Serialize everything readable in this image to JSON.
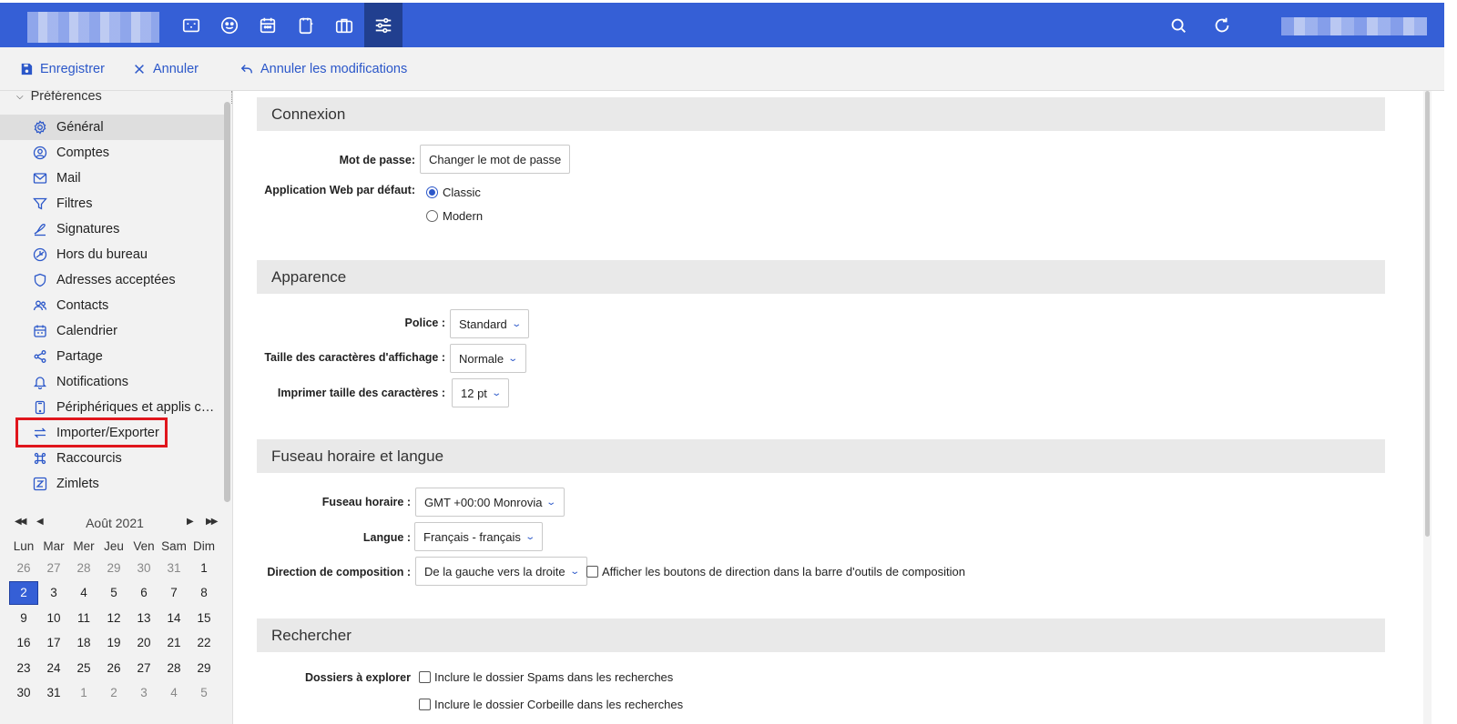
{
  "topbar": {
    "apps": [
      {
        "name": "mail-app-icon"
      },
      {
        "name": "contacts-app-icon"
      },
      {
        "name": "calendar-app-icon"
      },
      {
        "name": "tasks-app-icon"
      },
      {
        "name": "briefcase-app-icon"
      },
      {
        "name": "preferences-app-icon",
        "active": true
      }
    ],
    "accent": "#355fd6"
  },
  "toolbar": {
    "save_label": "Enregistrer",
    "cancel_label": "Annuler",
    "undo_label": "Annuler les modifications"
  },
  "sidebar": {
    "tree_label": "Préférences",
    "items": [
      {
        "label": "Général",
        "icon": "gear-icon",
        "active": true
      },
      {
        "label": "Comptes",
        "icon": "account-icon"
      },
      {
        "label": "Mail",
        "icon": "envelope-icon"
      },
      {
        "label": "Filtres",
        "icon": "filter-icon"
      },
      {
        "label": "Signatures",
        "icon": "signature-icon"
      },
      {
        "label": "Hors du bureau",
        "icon": "out-of-office-icon"
      },
      {
        "label": "Adresses acceptées",
        "icon": "shield-icon"
      },
      {
        "label": "Contacts",
        "icon": "people-icon"
      },
      {
        "label": "Calendrier",
        "icon": "calendar-icon"
      },
      {
        "label": "Partage",
        "icon": "share-icon"
      },
      {
        "label": "Notifications",
        "icon": "bell-icon"
      },
      {
        "label": "Périphériques et applis connectés",
        "icon": "device-icon"
      },
      {
        "label": "Importer/Exporter",
        "icon": "import-export-icon",
        "highlighted": true
      },
      {
        "label": "Raccourcis",
        "icon": "command-icon"
      },
      {
        "label": "Zimlets",
        "icon": "zimlet-icon"
      }
    ]
  },
  "calendar": {
    "month_label": "Août 2021",
    "weekdays": [
      "Lun",
      "Mar",
      "Mer",
      "Jeu",
      "Ven",
      "Sam",
      "Dim"
    ],
    "weeks": [
      [
        [
          "26",
          1
        ],
        [
          "27",
          1
        ],
        [
          "28",
          1
        ],
        [
          "29",
          1
        ],
        [
          "30",
          1
        ],
        [
          "31",
          1
        ],
        [
          "1",
          0
        ]
      ],
      [
        [
          "2",
          0
        ],
        [
          "3",
          0
        ],
        [
          "4",
          0
        ],
        [
          "5",
          0
        ],
        [
          "6",
          0
        ],
        [
          "7",
          0
        ],
        [
          "8",
          0
        ]
      ],
      [
        [
          "9",
          0
        ],
        [
          "10",
          0
        ],
        [
          "11",
          0
        ],
        [
          "12",
          0
        ],
        [
          "13",
          0
        ],
        [
          "14",
          0
        ],
        [
          "15",
          0
        ]
      ],
      [
        [
          "16",
          0
        ],
        [
          "17",
          0
        ],
        [
          "18",
          0
        ],
        [
          "19",
          0
        ],
        [
          "20",
          0
        ],
        [
          "21",
          0
        ],
        [
          "22",
          0
        ]
      ],
      [
        [
          "23",
          0
        ],
        [
          "24",
          0
        ],
        [
          "25",
          0
        ],
        [
          "26",
          0
        ],
        [
          "27",
          0
        ],
        [
          "28",
          0
        ],
        [
          "29",
          0
        ]
      ],
      [
        [
          "30",
          0
        ],
        [
          "31",
          0
        ],
        [
          "1",
          1
        ],
        [
          "2",
          1
        ],
        [
          "3",
          1
        ],
        [
          "4",
          1
        ],
        [
          "5",
          1
        ]
      ]
    ],
    "today": "2"
  },
  "main": {
    "connexion": {
      "title": "Connexion",
      "password_label": "Mot de passe:",
      "change_password_button": "Changer le mot de passe",
      "default_app_label": "Application Web par défaut:",
      "option_classic": "Classic",
      "option_modern": "Modern",
      "selected": "Classic"
    },
    "apparence": {
      "title": "Apparence",
      "font_label": "Police :",
      "font_value": "Standard",
      "size_label": "Taille des caractères d'affichage :",
      "size_value": "Normale",
      "print_label": "Imprimer taille des caractères :",
      "print_value": "12 pt"
    },
    "fuseau": {
      "title": "Fuseau horaire et langue",
      "tz_label": "Fuseau horaire :",
      "tz_value": "GMT +00:00 Monrovia",
      "lang_label": "Langue :",
      "lang_value": "Français - français",
      "dir_label": "Direction de composition :",
      "dir_value": "De la gauche vers la droite",
      "dir_buttons_label": "Afficher les boutons de direction dans la barre d'outils de composition"
    },
    "rechercher": {
      "title": "Rechercher",
      "folders_label": "Dossiers à explorer",
      "spam_label": "Inclure le dossier Spams dans les recherches",
      "trash_label": "Inclure le dossier Corbeille dans les recherches"
    }
  }
}
